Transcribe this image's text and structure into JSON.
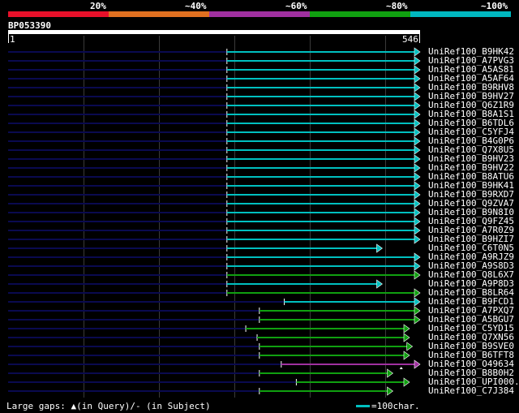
{
  "scale": {
    "labels": [
      "20%",
      "~40%",
      "~60%",
      "~80%",
      "~100%"
    ],
    "colors": [
      "#e8102a",
      "#e07020",
      "#a030a0",
      "#10a010",
      "#00b8c0"
    ]
  },
  "query": {
    "id": "BP053390",
    "start": "1",
    "end": "546",
    "length": 546
  },
  "colors": {
    "cyan": "#00c0c0",
    "green": "#10a010",
    "purple": "#a030a0",
    "dark": "#0a0a50"
  },
  "hits": [
    {
      "name": "UniRef100_B9HK42",
      "start": 290,
      "end": 546,
      "color": "cyan"
    },
    {
      "name": "UniRef100_A7PVG3",
      "start": 290,
      "end": 546,
      "color": "cyan"
    },
    {
      "name": "UniRef100_A5AS81",
      "start": 290,
      "end": 546,
      "color": "cyan"
    },
    {
      "name": "UniRef100_A5AF64",
      "start": 290,
      "end": 546,
      "color": "cyan"
    },
    {
      "name": "UniRef100_B9RHV8",
      "start": 290,
      "end": 546,
      "color": "cyan"
    },
    {
      "name": "UniRef100_B9HV27",
      "start": 290,
      "end": 546,
      "color": "cyan"
    },
    {
      "name": "UniRef100_Q6Z1R9",
      "start": 290,
      "end": 546,
      "color": "cyan"
    },
    {
      "name": "UniRef100_B8A1S1",
      "start": 290,
      "end": 546,
      "color": "cyan"
    },
    {
      "name": "UniRef100_B6TDL6",
      "start": 290,
      "end": 546,
      "color": "cyan"
    },
    {
      "name": "UniRef100_C5YFJ4",
      "start": 290,
      "end": 546,
      "color": "cyan"
    },
    {
      "name": "UniRef100_B4G0P6",
      "start": 290,
      "end": 546,
      "color": "cyan"
    },
    {
      "name": "UniRef100_Q7X8U5",
      "start": 290,
      "end": 546,
      "color": "cyan"
    },
    {
      "name": "UniRef100_B9HV23",
      "start": 290,
      "end": 546,
      "color": "cyan"
    },
    {
      "name": "UniRef100_B9HV22",
      "start": 290,
      "end": 546,
      "color": "cyan"
    },
    {
      "name": "UniRef100_B8ATU6",
      "start": 290,
      "end": 546,
      "color": "cyan"
    },
    {
      "name": "UniRef100_B9HK41",
      "start": 290,
      "end": 546,
      "color": "cyan"
    },
    {
      "name": "UniRef100_B9RXD7",
      "start": 290,
      "end": 546,
      "color": "cyan"
    },
    {
      "name": "UniRef100_Q9ZVA7",
      "start": 290,
      "end": 546,
      "color": "cyan"
    },
    {
      "name": "UniRef100_B9N8I0",
      "start": 290,
      "end": 546,
      "color": "cyan"
    },
    {
      "name": "UniRef100_Q9FZ45",
      "start": 290,
      "end": 546,
      "color": "cyan"
    },
    {
      "name": "UniRef100_A7R0Z9",
      "start": 290,
      "end": 546,
      "color": "cyan"
    },
    {
      "name": "UniRef100_B9HZI7",
      "start": 290,
      "end": 546,
      "color": "cyan"
    },
    {
      "name": "UniRef100_C6T0N5",
      "start": 290,
      "end": 496,
      "color": "cyan"
    },
    {
      "name": "UniRef100_A9RJZ9",
      "start": 290,
      "end": 546,
      "color": "cyan"
    },
    {
      "name": "UniRef100_A9S8D3",
      "start": 290,
      "end": 546,
      "color": "cyan"
    },
    {
      "name": "UniRef100_Q8L6X7",
      "start": 290,
      "end": 546,
      "color": "green"
    },
    {
      "name": "UniRef100_A9P8D3",
      "start": 290,
      "end": 496,
      "color": "cyan"
    },
    {
      "name": "UniRef100_B8LR64",
      "start": 290,
      "end": 546,
      "color": "green"
    },
    {
      "name": "UniRef100_B9FCD1",
      "start": 366,
      "end": 546,
      "color": "cyan"
    },
    {
      "name": "UniRef100_A7PXQ7",
      "start": 333,
      "end": 546,
      "color": "green"
    },
    {
      "name": "UniRef100_A5BGU7",
      "start": 333,
      "end": 546,
      "color": "green"
    },
    {
      "name": "UniRef100_C5YD15",
      "start": 315,
      "end": 532,
      "color": "green"
    },
    {
      "name": "UniRef100_Q7XN56",
      "start": 330,
      "end": 532,
      "color": "green"
    },
    {
      "name": "UniRef100_B9SVE0",
      "start": 333,
      "end": 536,
      "color": "green"
    },
    {
      "name": "UniRef100_B6TFT8",
      "start": 333,
      "end": 532,
      "color": "green"
    },
    {
      "name": "UniRef100_O49634",
      "start": 362,
      "end": 546,
      "color": "purple"
    },
    {
      "name": "UniRef100_B8B0H2",
      "start": 333,
      "end": 510,
      "color": "green"
    },
    {
      "name": "UniRef100_UPI000..",
      "start": 382,
      "end": 532,
      "color": "green"
    },
    {
      "name": "UniRef100_C7J384",
      "start": 333,
      "end": 510,
      "color": "green"
    }
  ],
  "footer": {
    "text": "Large gaps: ▲(in Query)/- (in Subject)",
    "legend": "=100char."
  }
}
